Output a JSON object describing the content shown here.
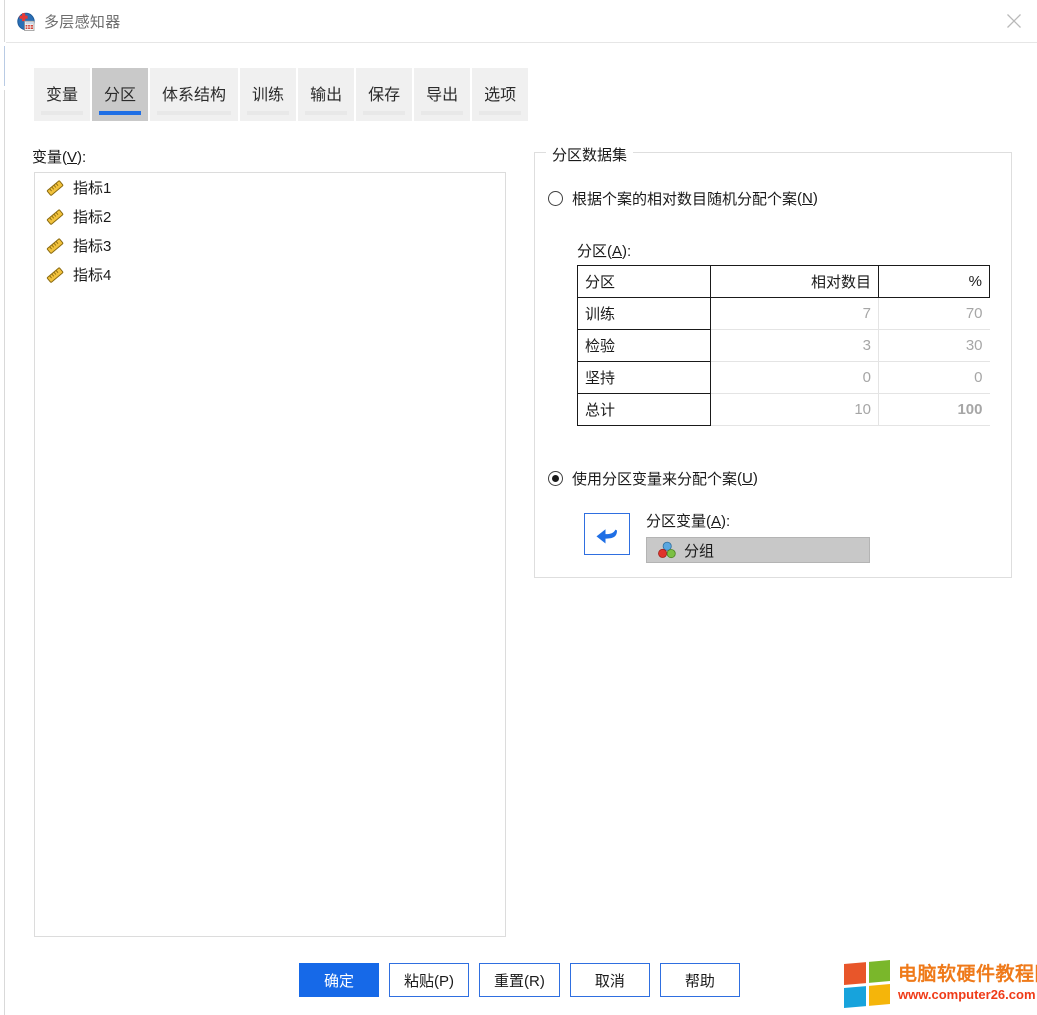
{
  "window": {
    "title": "多层感知器",
    "app_icon": "spss-mlp-icon",
    "close_label": "✕"
  },
  "tabs": [
    {
      "label": "变量",
      "active": false
    },
    {
      "label": "分区",
      "active": true
    },
    {
      "label": "体系结构",
      "active": false
    },
    {
      "label": "训练",
      "active": false
    },
    {
      "label": "输出",
      "active": false
    },
    {
      "label": "保存",
      "active": false
    },
    {
      "label": "导出",
      "active": false
    },
    {
      "label": "选项",
      "active": false
    }
  ],
  "variables_panel": {
    "label": "变量",
    "accelerator": "V",
    "suffix": ":",
    "items": [
      {
        "name": "指标1",
        "icon": "scale-icon"
      },
      {
        "name": "指标2",
        "icon": "scale-icon"
      },
      {
        "name": "指标3",
        "icon": "scale-icon"
      },
      {
        "name": "指标4",
        "icon": "scale-icon"
      }
    ]
  },
  "partition_group": {
    "title": "分区数据集",
    "random_option": {
      "label": "根据个案的相对数目随机分配个案",
      "accelerator": "N",
      "selected": false
    },
    "partition_table_label": "分区",
    "partition_table_accelerator": "A",
    "variable_option": {
      "label": "使用分区变量来分配个案",
      "accelerator": "U",
      "selected": true
    },
    "arrow_button": "move-left-arrow-icon",
    "partition_variable_label": "分区变量",
    "partition_variable_accelerator": "A",
    "partition_variable_value": "分组",
    "partition_variable_icon": "nominal-icon"
  },
  "chart_data": {
    "type": "table",
    "title": "分区",
    "columns": [
      "分区",
      "相对数目",
      "%"
    ],
    "rows": [
      {
        "name": "训练",
        "relative": "7",
        "percent": "70",
        "focused": false
      },
      {
        "name": "检验",
        "relative": "3",
        "percent": "30",
        "focused": false
      },
      {
        "name": "坚持",
        "relative": "0",
        "percent": "0",
        "focused": false
      },
      {
        "name": "总计",
        "relative": "10",
        "percent": "100",
        "focused": true
      }
    ]
  },
  "buttons": [
    {
      "label": "确定",
      "primary": true
    },
    {
      "label": "粘贴(P)",
      "primary": false
    },
    {
      "label": "重置(R)",
      "primary": false
    },
    {
      "label": "取消",
      "primary": false
    },
    {
      "label": "帮助",
      "primary": false
    }
  ],
  "watermark": {
    "title": "电脑软硬件教程网",
    "url": "www.computer26.com",
    "colors": [
      "#e8562a",
      "#7ab72b",
      "#17a3dc",
      "#f5b50a"
    ]
  },
  "colors": {
    "accent": "#1669e8",
    "tab_active_bg": "#c9c9c9",
    "tab_bg": "#f0f0f0",
    "disabled_text": "#a6a6a6"
  }
}
